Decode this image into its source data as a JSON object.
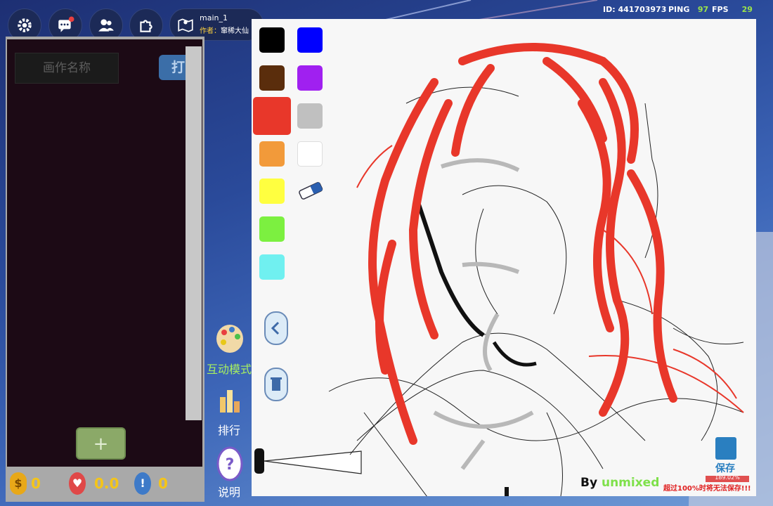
{
  "hud": {
    "map_name": "main_1",
    "author_label": "作者：",
    "author_name": "窜稀大仙",
    "id_label": "ID:",
    "id_value": "441703973",
    "ping_label": "PING",
    "ping_value": "97",
    "fps_label": "FPS",
    "fps_value": "29",
    "icons": [
      "gear-icon",
      "chat-icon",
      "friends-icon",
      "puzzle-icon",
      "map-icon"
    ]
  },
  "left_panel": {
    "name_placeholder": "画作名称",
    "open_button": "打",
    "add_button": "+",
    "currency": {
      "coins": "0",
      "likes": "0.0",
      "reports": "0"
    }
  },
  "mid": {
    "interactive_mode": "互动模式",
    "ranking": "排行",
    "instructions": "说明"
  },
  "palette": {
    "colors": [
      "#000000",
      "#0000ff",
      "#5a2d0c",
      "#a020f0",
      "#e8372a",
      "#c0c0c0",
      "#f29a3a",
      "#ffffff",
      "#ffff40",
      "#7cf040",
      "#70f0f0"
    ],
    "selected": "#e8372a",
    "tools": [
      "eraser-icon",
      "back-icon",
      "trash-icon",
      "brush-size-icon"
    ]
  },
  "canvas": {
    "byline_by": "By",
    "byline_user": "unmixed",
    "save_label": "保存",
    "progress": "189.02%",
    "warning": "超过100%时将无法保存!!!"
  }
}
